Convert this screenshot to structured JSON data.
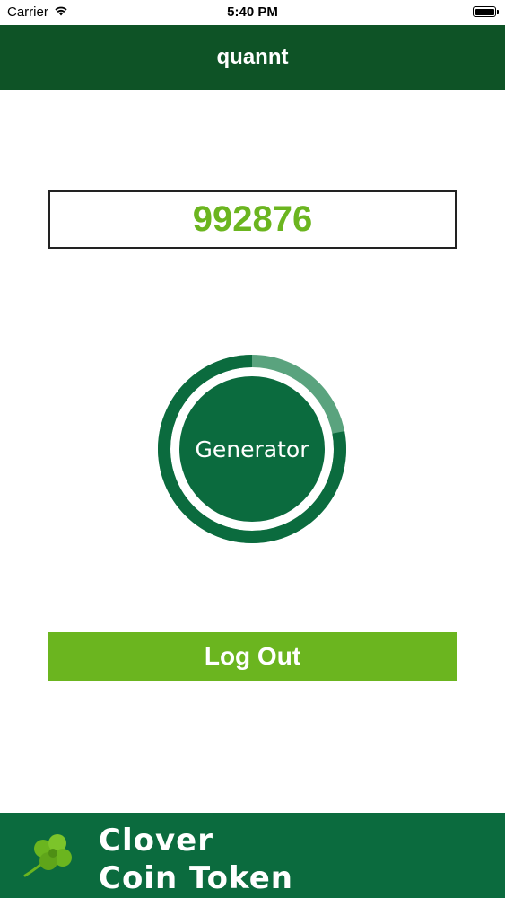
{
  "status_bar": {
    "carrier": "Carrier",
    "time": "5:40 PM",
    "wifi_icon": "wifi-icon",
    "battery_icon": "battery-icon",
    "battery_level": 1.0
  },
  "nav": {
    "title": "quannt"
  },
  "main": {
    "code": "992876",
    "generator_label": "Generator",
    "generator_progress": 0.78,
    "logout_label": "Log Out"
  },
  "footer": {
    "line1": "Clover",
    "line2": "Coin Token",
    "logo_icon": "clover-icon"
  },
  "colors": {
    "nav_background": "#0e5326",
    "primary_green": "#0b6b3e",
    "accent_green": "#6bb51f",
    "ring_remaining": "#5aa37e"
  }
}
